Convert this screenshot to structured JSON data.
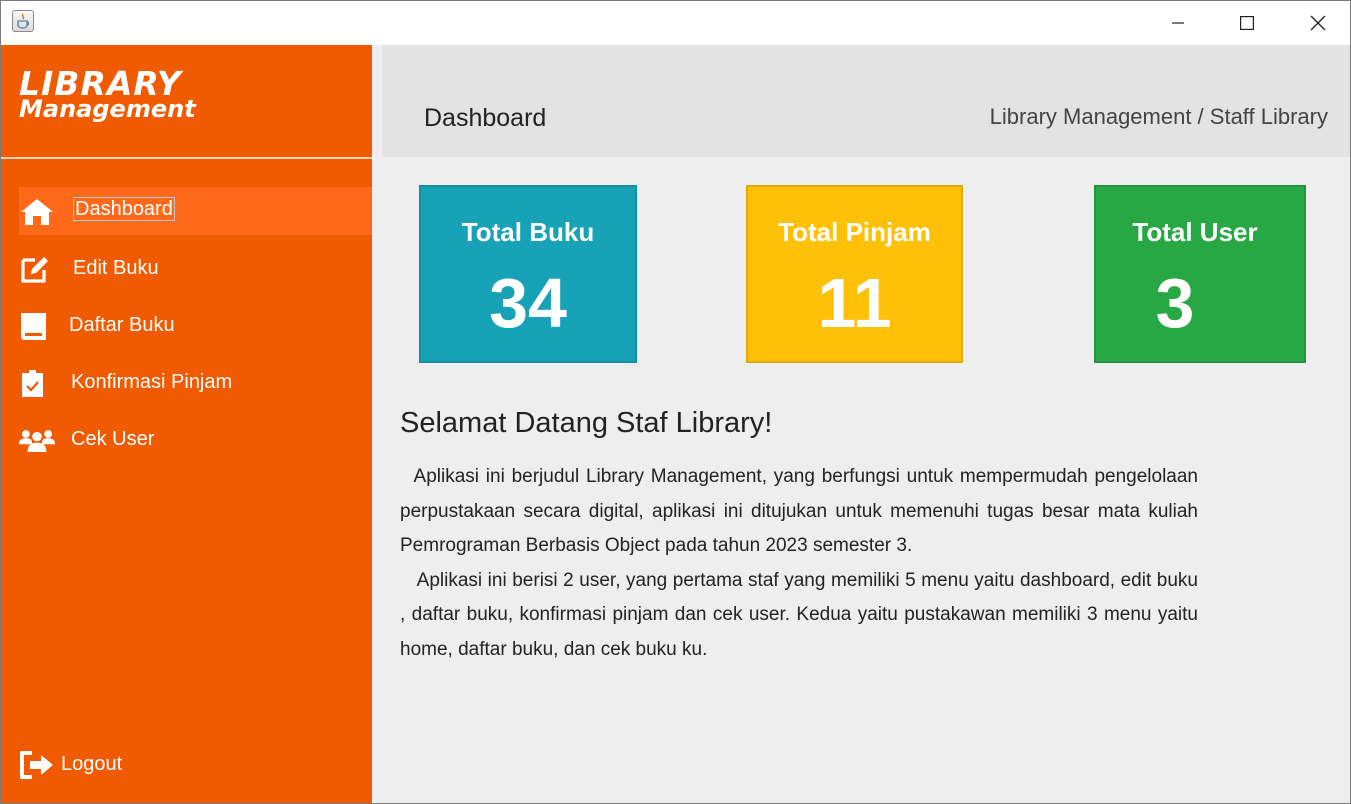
{
  "window": {
    "title": "",
    "controls": {
      "minimize_icon": "minimize-icon",
      "maximize_icon": "maximize-icon",
      "close_icon": "close-icon"
    }
  },
  "sidebar": {
    "logo_line1": "LIBRARY",
    "logo_line2": "Management",
    "items": [
      {
        "label": "Dashboard",
        "icon": "home-icon",
        "active": true
      },
      {
        "label": "Edit Buku",
        "icon": "edit-icon"
      },
      {
        "label": "Daftar Buku",
        "icon": "book-icon"
      },
      {
        "label": "Konfirmasi Pinjam",
        "icon": "clipboard-check-icon"
      },
      {
        "label": "Cek User",
        "icon": "users-icon"
      }
    ],
    "logout_label": "Logout"
  },
  "header": {
    "title": "Dashboard",
    "breadcrumb": "Library Management  / Staff Library"
  },
  "cards": [
    {
      "label": "Total Buku",
      "value": "34",
      "color": "#17a2b8"
    },
    {
      "label": "Total Pinjam",
      "value": "11",
      "color": "#ffc107"
    },
    {
      "label": "Total User",
      "value": "3",
      "color": "#28a745"
    }
  ],
  "welcome": {
    "title": "Selamat Datang Staf Library!",
    "paragraph1": "Aplikasi ini berjudul Library Management, yang berfungsi untuk mempermudah pengelolaan perpustakaan secara digital, aplikasi ini ditujukan untuk memenuhi tugas besar mata kuliah Pemrograman Berbasis Object pada tahun 2023 semester 3.",
    "paragraph2": "Aplikasi ini berisi 2 user, yang pertama staf yang memiliki 5 menu yaitu dashboard, edit buku , daftar buku, konfirmasi pinjam dan cek user. Kedua yaitu pustakawan memiliki 3 menu yaitu home, daftar buku, dan cek buku ku."
  },
  "colors": {
    "sidebar": "#f05a00",
    "active_item": "#ff6a1a",
    "main_bg": "#eeeeee",
    "header_bg": "#e3e3e3"
  }
}
